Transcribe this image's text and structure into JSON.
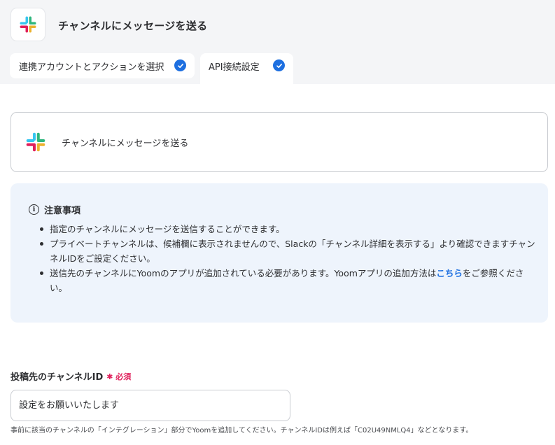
{
  "header": {
    "title": "チャンネルにメッセージを送る",
    "app_icon": "slack-logo"
  },
  "tabs": [
    {
      "label": "連携アカウントとアクションを選択",
      "completed": true
    },
    {
      "label": "API接続設定",
      "completed": true,
      "active": true
    }
  ],
  "action_card": {
    "label": "チャンネルにメッセージを送る",
    "icon": "slack-logo"
  },
  "notice": {
    "title": "注意事項",
    "items": [
      {
        "text": "指定のチャンネルにメッセージを送信することができます。"
      },
      {
        "text": "プライベートチャンネルは、候補欄に表示されませんので、Slackの「チャンネル詳細を表示する」より確認できますチャンネルIDをご設定ください。"
      },
      {
        "text_before": "送信先のチャンネルにYoomのアプリが追加されている必要があります。Yoomアプリの追加方法は",
        "link": "こちら",
        "text_after": "をご参照ください。"
      }
    ]
  },
  "field": {
    "label": "投稿先のチャンネルID",
    "required_label": "必須",
    "placeholder": "設定をお願いいたします",
    "hint": "事前に該当のチャンネルの「インテグレーション」部分でYoomを追加してください。チャンネルIDは例えば「C02U49NMLQ4」などとなります。"
  },
  "colors": {
    "accent": "#1d6fe0",
    "required": "#e0245e",
    "notice_bg": "#eef4fc",
    "header_bg": "#f4f5f7"
  }
}
